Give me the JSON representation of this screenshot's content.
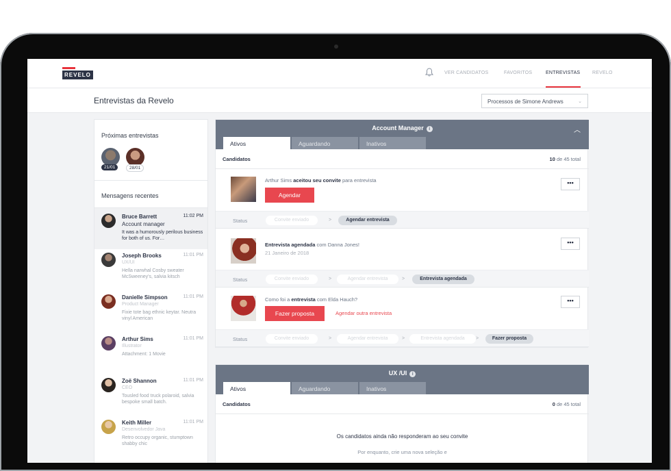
{
  "nav": {
    "logo": "REVELO",
    "links": [
      "VER CANDIDATOS",
      "FAVORITOS",
      "ENTREVISTAS",
      "REVELO"
    ]
  },
  "page": {
    "title": "Entrevistas da Revelo",
    "select_value": "Processos de Simone Andrews"
  },
  "sidebar": {
    "upcoming_title": "Próximas entrevistas",
    "upcoming": [
      {
        "date": "21/01"
      },
      {
        "date": "28/01"
      }
    ],
    "messages_title": "Mensagens recentes",
    "messages": [
      {
        "name": "Bruce Barrett",
        "time": "11:02 PM",
        "role": "Account manager",
        "text": "It was a humorously perilous business for both of us. For…"
      },
      {
        "name": "Joseph Brooks",
        "time": "11:01 PM",
        "role": "UX/UI",
        "text": "Hella narwhal Cosby sweater McSweeney's, salvia kitsch"
      },
      {
        "name": "Danielle Simpson",
        "time": "11:01 PM",
        "role": "Product Manager",
        "text": "Fixie tote bag ethnic keytar. Neutra vinyl American"
      },
      {
        "name": "Arthur Sims",
        "time": "11:01 PM",
        "role": "Illustrator",
        "text": "Attachment: 1 Movie"
      },
      {
        "name": "Zoë Shannon",
        "time": "11:01 PM",
        "role": "CEO",
        "text": "Tousled food truck polaroid, salvia bespoke small batch."
      },
      {
        "name": "Keith Miller",
        "time": "11:01 PM",
        "role": "Desenvolvedor Java",
        "text": "Retro occupy organic, stumptown shabby chic"
      }
    ]
  },
  "panel1": {
    "title": "Account Manager",
    "tabs": [
      "Ativos",
      "Aguardando",
      "Inativos"
    ],
    "candidates_label": "Candidatos",
    "count_bold": "10",
    "count_rest": " de 45 total",
    "status_label": "Status",
    "items": [
      {
        "pre": "Arthur Sims ",
        "bold": "aceitou seu convite",
        "post": " para entrevista",
        "button": "Agendar",
        "pills": [
          "Convite enviado",
          "Agendar entrevista"
        ]
      },
      {
        "pre": "",
        "bold": "Entrevista agendada",
        "post": " com Danna Jones!",
        "sub": "21 Janeiro de 2018",
        "pills": [
          "Convite enviado",
          "Agendar entrevista",
          "Entrevista agendada"
        ]
      },
      {
        "pre": "Como foi a ",
        "bold": "entrevista",
        "post": " com Elda Hauch?",
        "button": "Fazer proposta",
        "link": "Agendar outra entrevista",
        "pills": [
          "Convite enviado",
          "Agendar entrevista",
          "Entrevista agendada",
          "Fazer proposta"
        ]
      }
    ],
    "more": "•••"
  },
  "panel2": {
    "title": "UX /UI",
    "tabs": [
      "Ativos",
      "Aguardando",
      "Inativos"
    ],
    "candidates_label": "Candidatos",
    "count_bold": "0",
    "count_rest": " de 45 total",
    "empty_title": "Os candidatos ainda não responderam ao seu convite",
    "empty_sub": "Por enquanto, crie uma nova seleção e"
  },
  "colors": {
    "accent": "#e8474f",
    "header": "#6b7585",
    "navy": "#2d3446"
  }
}
